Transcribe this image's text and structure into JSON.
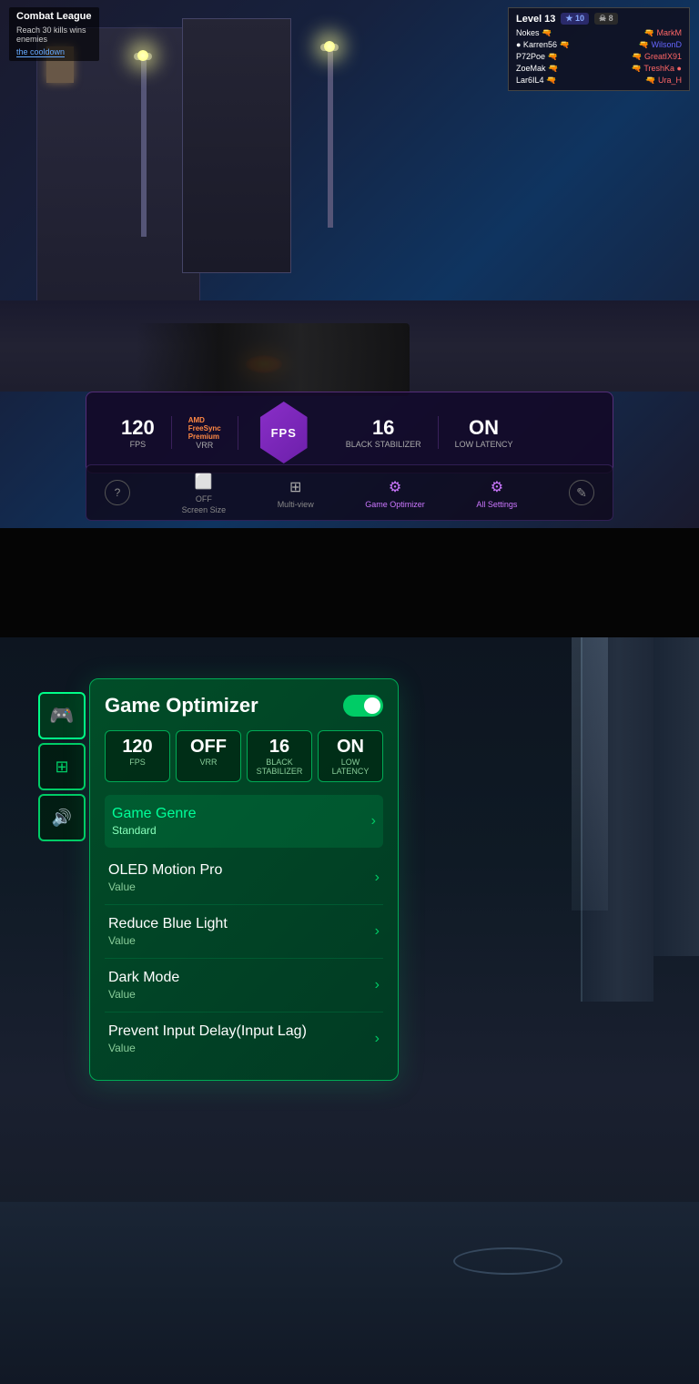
{
  "top_game": {
    "hud": {
      "game_mode": "Combat League",
      "kill_info": "Reach 30 kills wins",
      "enemy_label": "enemies",
      "cooldown_label": "the cooldown",
      "level_label": "Level 13",
      "star_count": "★ 10",
      "skull_count": "☠ 8",
      "players": [
        {
          "left": "Nokes",
          "right": "MarkM",
          "right_color": "red"
        },
        {
          "left": "Karren56",
          "right": "WilsonD",
          "right_color": "blue"
        },
        {
          "left": "P72Poe",
          "right": "GreatIX91",
          "right_color": "red"
        },
        {
          "left": "ZoeMak",
          "right": "TreshKa",
          "right_color": "red"
        },
        {
          "left": "Lar6IL4",
          "right": "Ura_H",
          "right_color": "red"
        }
      ]
    },
    "stats": {
      "fps_value": "120",
      "fps_label": "FPS",
      "vrr_label": "FreeSync",
      "vrr_sub": "Premium",
      "vrr_value": "VRR",
      "center_label": "FPS",
      "black_value": "16",
      "black_label": "Black Stabilizer",
      "latency_value": "ON",
      "latency_label": "Low Latency"
    },
    "nav": {
      "help_label": "?",
      "screen_size_label": "Screen Size",
      "screen_size_value": "OFF",
      "multi_view_label": "Multi-view",
      "game_optimizer_label": "Game Optimizer",
      "all_settings_label": "All Settings",
      "edit_label": "✎"
    }
  },
  "bottom_game": {
    "optimizer": {
      "title": "Game Optimizer",
      "toggle_state": "on",
      "stats": {
        "fps_value": "120",
        "fps_label": "FPS",
        "vrr_value": "OFF",
        "vrr_label": "VRR",
        "black_value": "16",
        "black_label": "Black Stabilizer",
        "latency_value": "ON",
        "latency_label": "Low Latency"
      },
      "menu_items": [
        {
          "id": "game-genre",
          "title": "Game Genre",
          "value": "Standard",
          "highlighted": true
        },
        {
          "id": "oled-motion",
          "title": "OLED Motion Pro",
          "value": "Value",
          "highlighted": false
        },
        {
          "id": "reduce-blue",
          "title": "Reduce Blue Light",
          "value": "Value",
          "highlighted": false
        },
        {
          "id": "dark-mode",
          "title": "Dark Mode",
          "value": "Value",
          "highlighted": false
        },
        {
          "id": "prevent-input",
          "title": "Prevent Input Delay(Input Lag)",
          "value": "Value",
          "highlighted": false
        }
      ]
    },
    "sidebar": {
      "buttons": [
        {
          "id": "gamepad",
          "icon": "🎮",
          "active": true
        },
        {
          "id": "grid",
          "icon": "⊞",
          "active": false
        },
        {
          "id": "volume",
          "icon": "🔊",
          "active": false
        }
      ]
    }
  }
}
